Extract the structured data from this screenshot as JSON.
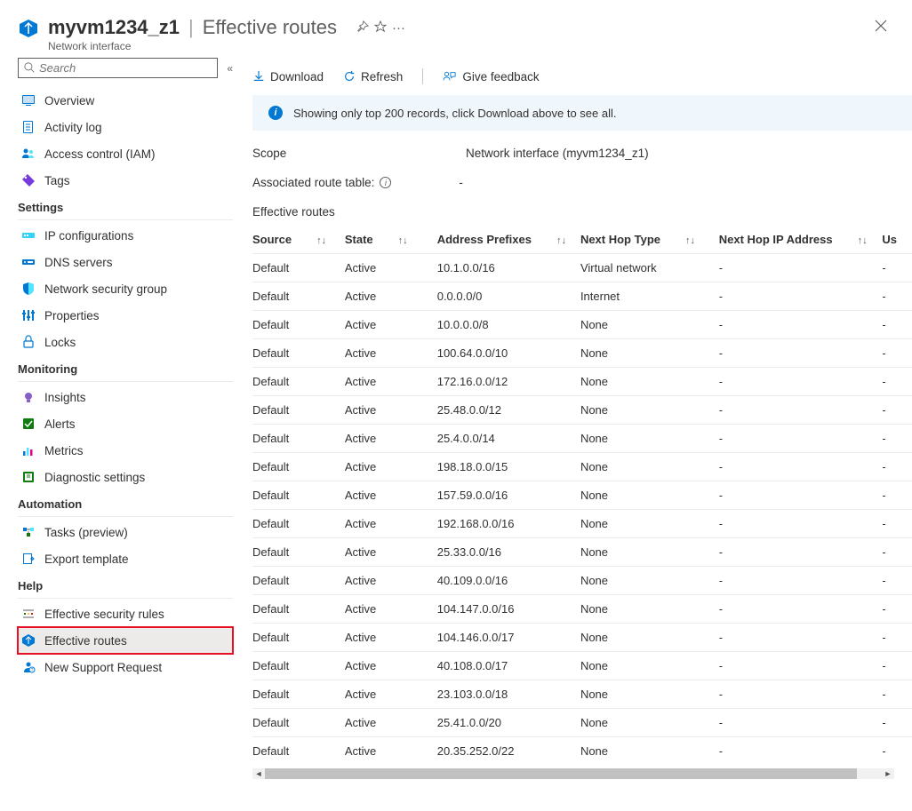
{
  "header": {
    "resource_name": "myvm1234_z1",
    "page_title": "Effective routes",
    "subtitle": "Network interface"
  },
  "search": {
    "placeholder": "Search"
  },
  "sidebar": {
    "top": [
      {
        "label": "Overview",
        "name": "nav-overview",
        "icon": "screen"
      },
      {
        "label": "Activity log",
        "name": "nav-activity-log",
        "icon": "log"
      },
      {
        "label": "Access control (IAM)",
        "name": "nav-access-control",
        "icon": "iam"
      },
      {
        "label": "Tags",
        "name": "nav-tags",
        "icon": "tag"
      }
    ],
    "settings_label": "Settings",
    "settings": [
      {
        "label": "IP configurations",
        "name": "nav-ip-configurations",
        "icon": "ipconfig"
      },
      {
        "label": "DNS servers",
        "name": "nav-dns-servers",
        "icon": "dns"
      },
      {
        "label": "Network security group",
        "name": "nav-nsg",
        "icon": "shield"
      },
      {
        "label": "Properties",
        "name": "nav-properties",
        "icon": "properties"
      },
      {
        "label": "Locks",
        "name": "nav-locks",
        "icon": "lock"
      }
    ],
    "monitoring_label": "Monitoring",
    "monitoring": [
      {
        "label": "Insights",
        "name": "nav-insights",
        "icon": "bulb"
      },
      {
        "label": "Alerts",
        "name": "nav-alerts",
        "icon": "alert"
      },
      {
        "label": "Metrics",
        "name": "nav-metrics",
        "icon": "metrics"
      },
      {
        "label": "Diagnostic settings",
        "name": "nav-diagnostic-settings",
        "icon": "diag"
      }
    ],
    "automation_label": "Automation",
    "automation": [
      {
        "label": "Tasks (preview)",
        "name": "nav-tasks",
        "icon": "tasks"
      },
      {
        "label": "Export template",
        "name": "nav-export-template",
        "icon": "export"
      }
    ],
    "help_label": "Help",
    "help": [
      {
        "label": "Effective security rules",
        "name": "nav-effective-security-rules",
        "icon": "esr"
      },
      {
        "label": "Effective routes",
        "name": "nav-effective-routes",
        "icon": "routes"
      },
      {
        "label": "New Support Request",
        "name": "nav-new-support-request",
        "icon": "support"
      }
    ]
  },
  "toolbar": {
    "download": "Download",
    "refresh": "Refresh",
    "feedback": "Give feedback"
  },
  "info_bar": "Showing only top 200 records, click Download above to see all.",
  "scope": {
    "label": "Scope",
    "value": "Network interface (myvm1234_z1)"
  },
  "associated": {
    "label": "Associated route table:",
    "value": "-"
  },
  "table": {
    "title": "Effective routes",
    "columns": {
      "source": "Source",
      "state": "State",
      "address_prefixes": "Address Prefixes",
      "next_hop_type": "Next Hop Type",
      "next_hop_ip": "Next Hop IP Address",
      "us": "Us"
    },
    "rows": [
      {
        "source": "Default",
        "state": "Active",
        "prefix": "10.1.0.0/16",
        "nht": "Virtual network",
        "nhip": "-",
        "us": "-"
      },
      {
        "source": "Default",
        "state": "Active",
        "prefix": "0.0.0.0/0",
        "nht": "Internet",
        "nhip": "-",
        "us": "-"
      },
      {
        "source": "Default",
        "state": "Active",
        "prefix": "10.0.0.0/8",
        "nht": "None",
        "nhip": "-",
        "us": "-"
      },
      {
        "source": "Default",
        "state": "Active",
        "prefix": "100.64.0.0/10",
        "nht": "None",
        "nhip": "-",
        "us": "-"
      },
      {
        "source": "Default",
        "state": "Active",
        "prefix": "172.16.0.0/12",
        "nht": "None",
        "nhip": "-",
        "us": "-"
      },
      {
        "source": "Default",
        "state": "Active",
        "prefix": "25.48.0.0/12",
        "nht": "None",
        "nhip": "-",
        "us": "-"
      },
      {
        "source": "Default",
        "state": "Active",
        "prefix": "25.4.0.0/14",
        "nht": "None",
        "nhip": "-",
        "us": "-"
      },
      {
        "source": "Default",
        "state": "Active",
        "prefix": "198.18.0.0/15",
        "nht": "None",
        "nhip": "-",
        "us": "-"
      },
      {
        "source": "Default",
        "state": "Active",
        "prefix": "157.59.0.0/16",
        "nht": "None",
        "nhip": "-",
        "us": "-"
      },
      {
        "source": "Default",
        "state": "Active",
        "prefix": "192.168.0.0/16",
        "nht": "None",
        "nhip": "-",
        "us": "-"
      },
      {
        "source": "Default",
        "state": "Active",
        "prefix": "25.33.0.0/16",
        "nht": "None",
        "nhip": "-",
        "us": "-"
      },
      {
        "source": "Default",
        "state": "Active",
        "prefix": "40.109.0.0/16",
        "nht": "None",
        "nhip": "-",
        "us": "-"
      },
      {
        "source": "Default",
        "state": "Active",
        "prefix": "104.147.0.0/16",
        "nht": "None",
        "nhip": "-",
        "us": "-"
      },
      {
        "source": "Default",
        "state": "Active",
        "prefix": "104.146.0.0/17",
        "nht": "None",
        "nhip": "-",
        "us": "-"
      },
      {
        "source": "Default",
        "state": "Active",
        "prefix": "40.108.0.0/17",
        "nht": "None",
        "nhip": "-",
        "us": "-"
      },
      {
        "source": "Default",
        "state": "Active",
        "prefix": "23.103.0.0/18",
        "nht": "None",
        "nhip": "-",
        "us": "-"
      },
      {
        "source": "Default",
        "state": "Active",
        "prefix": "25.41.0.0/20",
        "nht": "None",
        "nhip": "-",
        "us": "-"
      },
      {
        "source": "Default",
        "state": "Active",
        "prefix": "20.35.252.0/22",
        "nht": "None",
        "nhip": "-",
        "us": "-"
      }
    ]
  }
}
